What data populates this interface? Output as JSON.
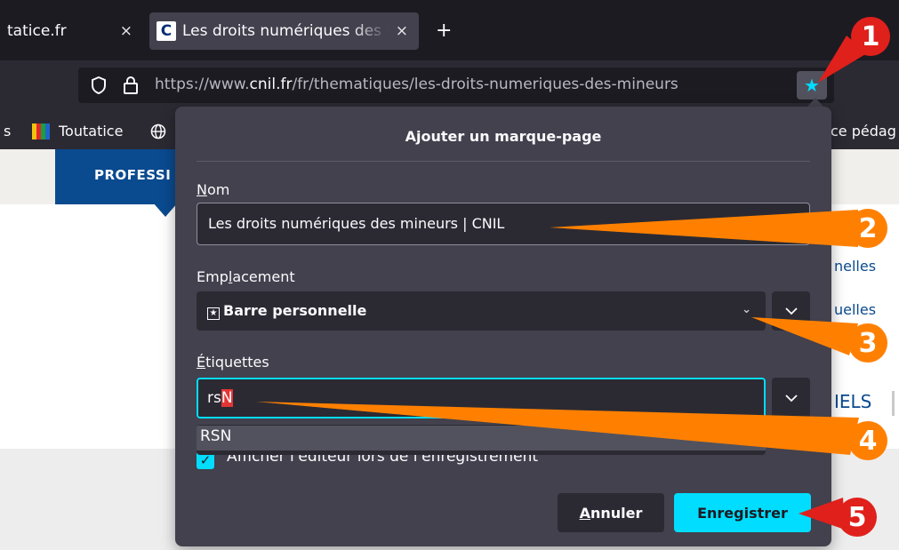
{
  "tabs": [
    {
      "title": "tatice.fr",
      "close": "×",
      "active": false
    },
    {
      "title": "Les droits numériques des mineurs | CNIL",
      "favicon": "C",
      "close": "×",
      "active": true
    }
  ],
  "new_tab": "+",
  "url": {
    "prefix": "https://www.",
    "domain": "cnil.fr",
    "path": "/fr/thematiques/les-droits-numeriques-des-mineurs"
  },
  "bookmarks_bar": {
    "left_fragment": "s",
    "item": "Toutatice",
    "right_fragment": "ce pédag"
  },
  "page": {
    "nav_label": "PROFESSI",
    "link1": "nelles",
    "link2": "uelles",
    "link3": "IELS"
  },
  "dialog": {
    "title": "Ajouter un marque-page",
    "name_label_ul": "N",
    "name_label_rest": "om",
    "name_value": "Les droits numériques des mineurs | CNIL",
    "folder_label_a": "Emp",
    "folder_label_ul": "l",
    "folder_label_b": "acement",
    "folder_value": "Barre personnelle",
    "tags_label_ul": "É",
    "tags_label_rest": "tiquettes",
    "tags_typed": "rs",
    "tags_completed": "N",
    "suggestion": "RSN",
    "show_editor": "Afficher l'éditeur lors de l'enregistrement",
    "cancel_ul": "A",
    "cancel_rest": "nnuler",
    "save": "Enregistrer"
  },
  "callouts": {
    "n1": "1",
    "n2": "2",
    "n3": "3",
    "n4": "4",
    "n5": "5"
  },
  "colors": {
    "accent": "#00ddff",
    "callout_orange": "#ff8000",
    "callout_red": "#e0201b",
    "cnil_blue": "#0a4a8f"
  }
}
